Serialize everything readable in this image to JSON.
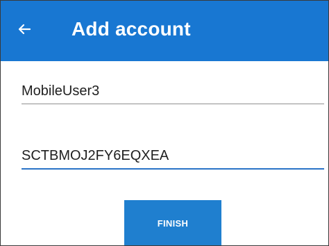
{
  "colors": {
    "app_bar": "#1877d2",
    "title_text": "#ffffff",
    "active_field_underline": "#2a73c7",
    "field_underline": "#8f8f8f",
    "button_bg": "#1f7fcf",
    "button_text": "#ffffff",
    "page_bg": "#ffffff"
  },
  "app_bar": {
    "title": "Add account",
    "back_icon": "arrow-left-icon"
  },
  "form": {
    "username": {
      "value": "MobileUser3"
    },
    "code": {
      "value": "SCTBMOJ2FY6EQXEA"
    }
  },
  "actions": {
    "finish_label": "FINISH"
  }
}
